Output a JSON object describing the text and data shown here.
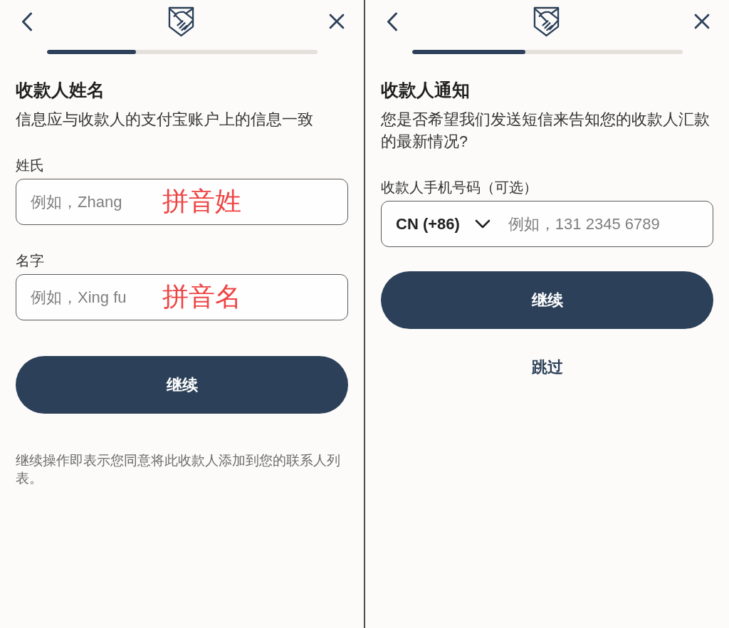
{
  "screens": [
    {
      "progress": {
        "level": 0.33
      },
      "title": "收款人姓名",
      "description": "信息应与收款人的支付宝账户上的信息一致",
      "fields": [
        {
          "kind": "text",
          "label": "姓氏",
          "placeholder": "例如，Zhang",
          "annotation": "拼音姓"
        },
        {
          "kind": "text",
          "label": "名字",
          "placeholder": "例如，Xing fu",
          "annotation": "拼音名"
        }
      ],
      "primary_button": "继续",
      "footnote": "继续操作即表示您同意将此收款人添加到您的联系人列表。"
    },
    {
      "progress": {
        "level": 0.42
      },
      "title": "收款人通知",
      "description": "您是否希望我们发送短信来告知您的收款人汇款的最新情况?",
      "fields": [
        {
          "kind": "phone",
          "label": "收款人手机号码（可选）",
          "country_code": "CN (+86)",
          "placeholder": "例如，131 2345 6789"
        }
      ],
      "primary_button": "继续",
      "secondary_link": "跳过"
    }
  ]
}
